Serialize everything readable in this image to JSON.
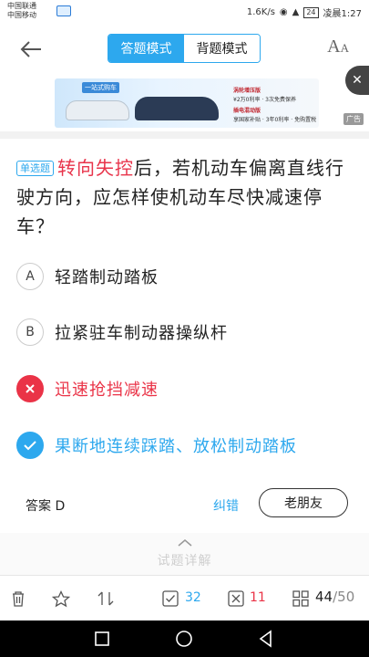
{
  "status_bar": {
    "carrier_1": "中国联通",
    "carrier_2": "中国移动",
    "speed": "1.6K/s",
    "battery": "24",
    "time": "凌晨1:27"
  },
  "header": {
    "mode_tabs": [
      "答题模式",
      "背题模式"
    ],
    "active_mode": 0,
    "font_icon": "font-size-icon"
  },
  "ad": {
    "headline": "一站式购车",
    "line_1": "涡轮增压版",
    "line_2": "¥2万0利率 · 3次免费保养",
    "line_3": "插电混动版",
    "line_4": "享国家补贴 · 3年0利率 · 免购置税",
    "tag": "广告"
  },
  "question": {
    "type_label": "单选题",
    "highlight": "转向失控",
    "text": "后，若机动车偏离直线行驶方向，应怎样使机动车尽快减速停车？"
  },
  "options": [
    {
      "letter": "A",
      "text": "轻踏制动踏板",
      "state": "normal"
    },
    {
      "letter": "B",
      "text": "拉紧驻车制动器操纵杆",
      "state": "normal"
    },
    {
      "letter": "C",
      "text": "迅速抢挡减速",
      "state": "wrong"
    },
    {
      "letter": "D",
      "text": "果断地连续踩踏、放松制动踏板",
      "state": "right"
    }
  ],
  "answer_text": "答案 D",
  "report_label": "纠错",
  "old_friend_label": "老朋友",
  "explain_label": "试题详解",
  "toolbar": {
    "correct_count": "32",
    "wrong_count": "11",
    "progress_current": "44",
    "progress_total": "/50"
  },
  "colors": {
    "accent": "#2da8ee",
    "error": "#ea3347"
  }
}
